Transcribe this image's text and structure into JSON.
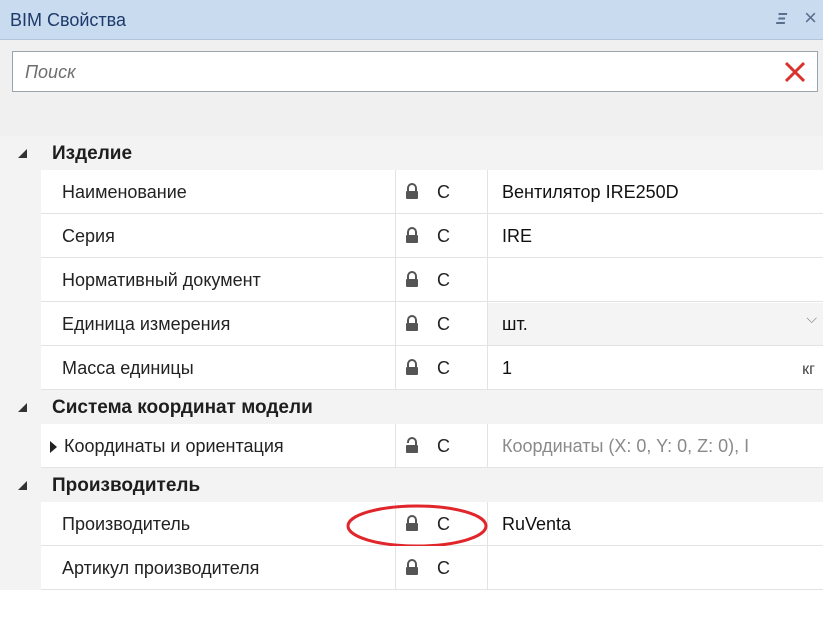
{
  "panel": {
    "title": "BIM Свойства",
    "pin_icon": "pin-icon",
    "close_icon": "close-icon"
  },
  "search": {
    "placeholder": "Поиск",
    "value": "",
    "clear_icon": "clear-x-icon",
    "clear_color": "#d9322a"
  },
  "categories": [
    {
      "label": "Изделие",
      "rows": [
        {
          "name": "Наименование",
          "flag": "C",
          "value": "Вентилятор IRE250D"
        },
        {
          "name": "Серия",
          "flag": "C",
          "value": "IRE"
        },
        {
          "name": "Нормативный документ",
          "flag": "C",
          "value": ""
        },
        {
          "name": "Единица измерения",
          "flag": "C",
          "value": "шт."
        },
        {
          "name": "Масса единицы",
          "flag": "C",
          "value": "1",
          "unit": "кг"
        }
      ]
    },
    {
      "label": "Система координат модели",
      "rows": [
        {
          "name": "Координаты и ориентация",
          "flag": "C",
          "value": "Координаты (X: 0, Y: 0, Z: 0), I"
        }
      ]
    },
    {
      "label": "Производитель",
      "rows": [
        {
          "name": "Производитель",
          "flag": "C",
          "value": "RuVenta"
        },
        {
          "name": "Артикул производителя",
          "flag": "C",
          "value": ""
        }
      ]
    }
  ],
  "colors": {
    "titlebar": "#c9dbee",
    "highlight_circle": "#e0262b"
  }
}
